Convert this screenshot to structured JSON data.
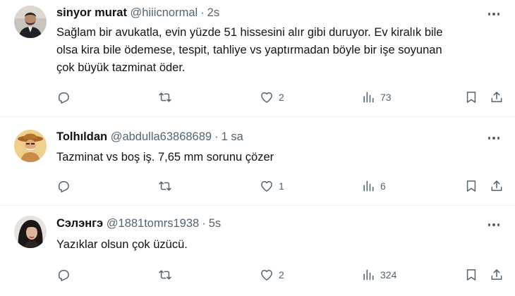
{
  "tweets": [
    {
      "name": "sinyor murat",
      "handle": "@hiiicnormal",
      "time": "2s",
      "text_lines": [
        "Sağlam bir avukatla, evin yüzde 51 hissesini alır gibi duruyor. Ev kiralık bile",
        "olsa kira bile ödemese, tespit, tahliye vs yaptırmadan böyle bir işe soyunan",
        "çok büyük tazminat öder."
      ],
      "replies": "",
      "retweets": "",
      "likes": "2",
      "views": "73"
    },
    {
      "name": "Tolhıldan",
      "handle": "@abdulla63868689",
      "time": "1 sa",
      "text_lines": [
        "Tazminat vs boş iş. 7,65 mm sorunu çözer"
      ],
      "replies": "",
      "retweets": "",
      "likes": "1",
      "views": "6"
    },
    {
      "name": "Сэлэнгэ",
      "handle": "@1881tomrs1938",
      "time": "5s",
      "text_lines": [
        "Yazıklar olsun çok üzücü."
      ],
      "replies": "",
      "retweets": "",
      "likes": "2",
      "views": "324"
    }
  ],
  "separator": "·",
  "icons": {
    "more": "more-horizontal-icon",
    "reply": "reply-icon",
    "retweet": "retweet-icon",
    "like": "heart-icon",
    "views": "views-chart-icon",
    "bookmark": "bookmark-icon",
    "share": "share-icon"
  },
  "colors": {
    "text": "#0f1419",
    "secondary": "#536471",
    "divider": "#eff3f4"
  }
}
